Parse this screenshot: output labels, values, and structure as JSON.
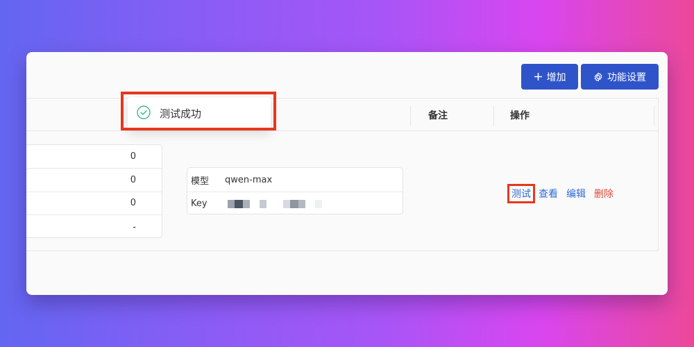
{
  "toolbar": {
    "add_label": "增加",
    "settings_label": "功能设置",
    "add_icon": "plus-icon",
    "settings_icon": "gear-icon"
  },
  "table": {
    "headers": [
      "备注",
      "操作"
    ],
    "stats_values": [
      "0",
      "0",
      "0",
      "-"
    ],
    "info": {
      "model_label": "模型",
      "model_value": "qwen-max",
      "key_label": "Key"
    },
    "actions": {
      "test": "测试",
      "view": "查看",
      "edit": "编辑",
      "delete": "删除"
    }
  },
  "toast": {
    "message": "测试成功",
    "icon": "check-circle-icon"
  },
  "colors": {
    "primary": "#2f54c9",
    "link": "#2f6bd9",
    "danger": "#e14b3b",
    "success": "#3db88a",
    "highlight": "#e8361c"
  }
}
